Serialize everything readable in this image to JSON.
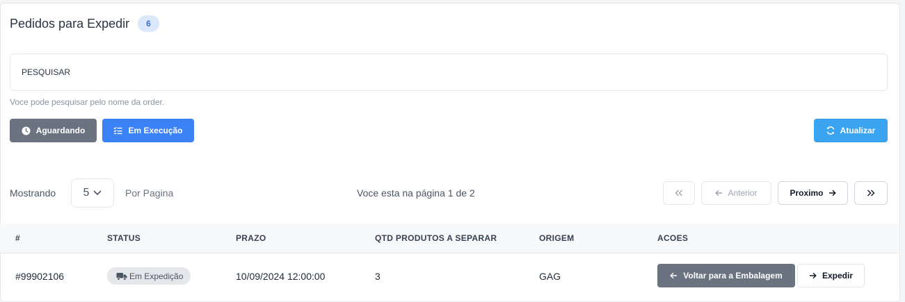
{
  "header": {
    "title": "Pedidos para Expedir",
    "count": "6"
  },
  "search": {
    "placeholder": "PESQUISAR",
    "hint": "Voce pode pesquisar pelo nome da order."
  },
  "filters": {
    "waiting_label": "Aguardando",
    "executing_label": "Em Execução",
    "refresh_label": "Atualizar"
  },
  "pagination": {
    "showing_label": "Mostrando",
    "per_page_value": "5",
    "per_page_label": "Por Pagina",
    "page_info": "Voce esta na página 1 de 2",
    "prev_label": "Anterior",
    "next_label": "Proximo"
  },
  "table": {
    "columns": [
      "#",
      "STATUS",
      "PRAZO",
      "QTD PRODUTOS A SEPARAR",
      "ORIGEM",
      "ACOES"
    ],
    "rows": [
      {
        "id": "#99902106",
        "status": "Em Expedição",
        "deadline": "10/09/2024 12:00:00",
        "qty": "3",
        "origin": "GAG",
        "back_label": "Voltar para a Embalagem",
        "ship_label": "Expedir"
      }
    ]
  },
  "colors": {
    "primary": "#3b82f6",
    "secondary": "#6b7280",
    "refresh": "#3ba4f0",
    "badge_bg": "#dbe8fb"
  },
  "icons": [
    "clock-icon",
    "list-check-icon",
    "refresh-icon",
    "chevron-down-icon",
    "double-left-icon",
    "arrow-left-icon",
    "arrow-right-icon",
    "double-right-icon",
    "truck-icon"
  ]
}
